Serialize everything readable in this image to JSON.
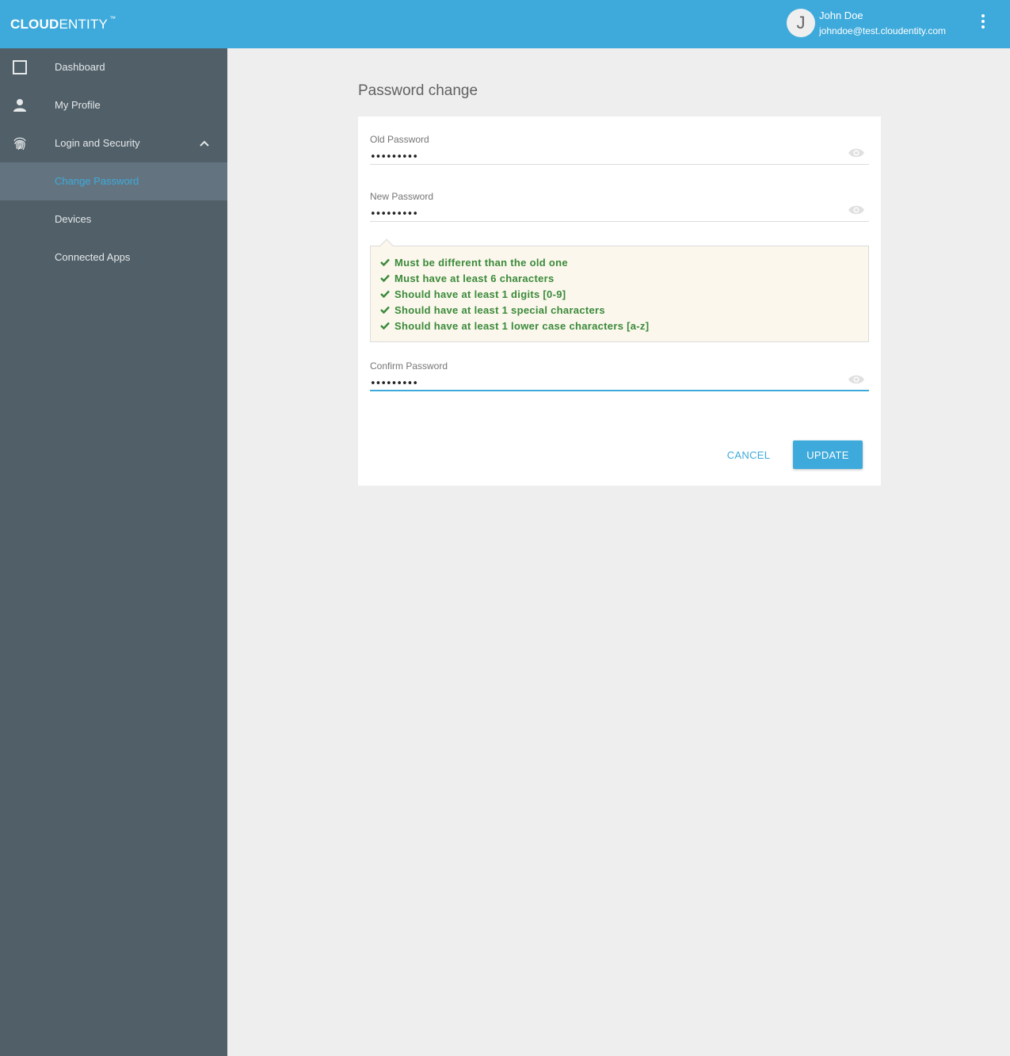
{
  "header": {
    "logo_bold": "CLOUD",
    "logo_light": "ENTITY",
    "logo_tm": "™",
    "user": {
      "avatar_initial": "J",
      "name": "John Doe",
      "email": "johndoe@test.cloudentity.com"
    },
    "menu_icon": "more-vert-icon"
  },
  "sidebar": {
    "items": [
      {
        "label": "Dashboard",
        "icon": "dashboard-square-icon"
      },
      {
        "label": "My Profile",
        "icon": "person-icon"
      },
      {
        "label": "Login and Security",
        "icon": "fingerprint-icon",
        "expanded": true
      },
      {
        "label": "Change Password",
        "active": true
      },
      {
        "label": "Devices"
      },
      {
        "label": "Connected Apps"
      }
    ]
  },
  "main": {
    "title": "Password change",
    "fields": [
      {
        "label": "Old Password",
        "value": "•••••••••"
      },
      {
        "label": "New Password",
        "value": "•••••••••"
      },
      {
        "label": "Confirm Password",
        "value": "•••••••••",
        "focused": true
      }
    ],
    "rules": [
      "Must be different than the old one",
      "Must have at least 6 characters",
      "Should have at least 1 digits [0-9]",
      "Should have at least 1 special characters",
      "Should have at least 1 lower case characters [a-z]"
    ],
    "buttons": {
      "cancel": "CANCEL",
      "update": "UPDATE"
    }
  },
  "colors": {
    "brand": "#3eaadb",
    "sidebar": "#505f68",
    "sidebar_active": "#637480",
    "rule_ok": "#3a8a3a",
    "rules_bg": "#fbf7ec"
  }
}
